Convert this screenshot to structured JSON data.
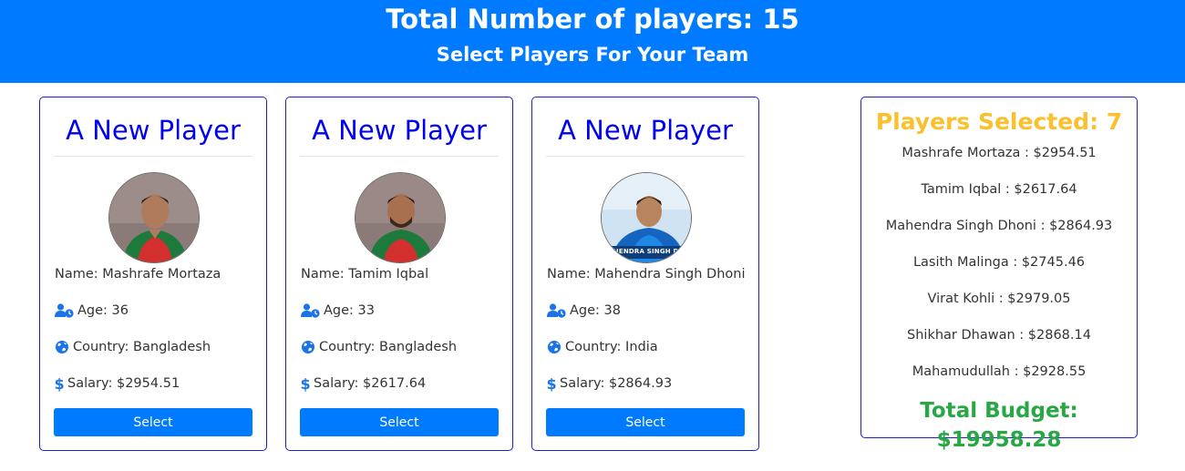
{
  "header": {
    "total": "Total Number of players: 15",
    "subtitle": "Select Players For Your Team"
  },
  "cards": [
    {
      "title": "A New Player",
      "name": "Name: Mashrafe Mortaza",
      "age": "Age: 36",
      "country": "Country: Bangladesh",
      "salary": "Salary: $2954.51",
      "button": "Select"
    },
    {
      "title": "A New Player",
      "name": "Name: Tamim Iqbal",
      "age": "Age: 33",
      "country": "Country: Bangladesh",
      "salary": "Salary: $2617.64",
      "button": "Select"
    },
    {
      "title": "A New Player",
      "name": "Name: Mahendra Singh Dhoni",
      "age": "Age: 38",
      "country": "Country: India",
      "salary": "Salary: $2864.93",
      "button": "Select",
      "photo_caption": "MAHENDRA SINGH DHONI"
    }
  ],
  "summary": {
    "title": "Players Selected: 7",
    "players": [
      "Mashrafe Mortaza : $2954.51",
      "Tamim Iqbal : $2617.64",
      "Mahendra Singh Dhoni : $2864.93",
      "Lasith Malinga : $2745.46",
      "Virat Kohli : $2979.05",
      "Shikhar Dhawan : $2868.14",
      "Mahamudullah : $2928.55"
    ],
    "budget": "Total Budget: $19958.28"
  },
  "colors": {
    "primary": "#007bff",
    "card_border": "#1f1fc8",
    "card_title": "#0000ee",
    "selected_title": "#fbc02d",
    "budget": "#28a745"
  },
  "icons": {
    "age": "user-clock-icon",
    "country": "globe-icon",
    "salary": "dollar-icon"
  }
}
